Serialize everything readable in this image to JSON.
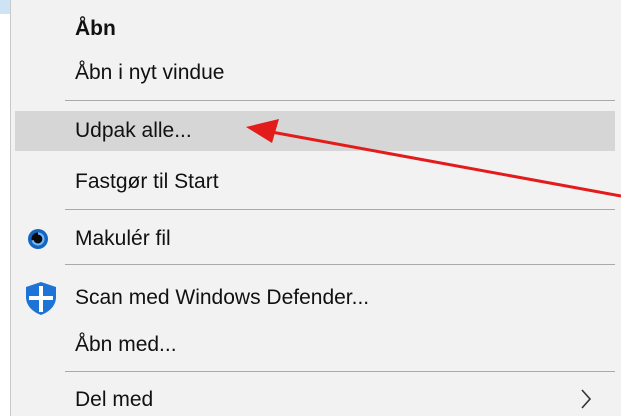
{
  "context_menu": {
    "items": [
      {
        "label": "Åbn"
      },
      {
        "label": "Åbn i nyt vindue"
      },
      {
        "label": "Udpak alle..."
      },
      {
        "label": "Fastgør til Start"
      },
      {
        "label": "Makulér fil",
        "icon": "shredder-icon"
      },
      {
        "label": "Scan med Windows Defender...",
        "icon": "windows-defender-shield-icon"
      },
      {
        "label": "Åbn med..."
      },
      {
        "label": "Del med",
        "submenu_icon": "chevron-right-icon"
      }
    ],
    "highlighted_item_index": 2
  },
  "annotation": {
    "type": "arrow",
    "color": "#e31b1b",
    "points_to": "Udpak alle..."
  },
  "colors": {
    "menu_background": "#f2f2f2",
    "highlight": "#d6d6d6",
    "separator": "#a9a9a9",
    "shield_blue": "#1e73d6",
    "shredder_blue": "#1565c0"
  }
}
